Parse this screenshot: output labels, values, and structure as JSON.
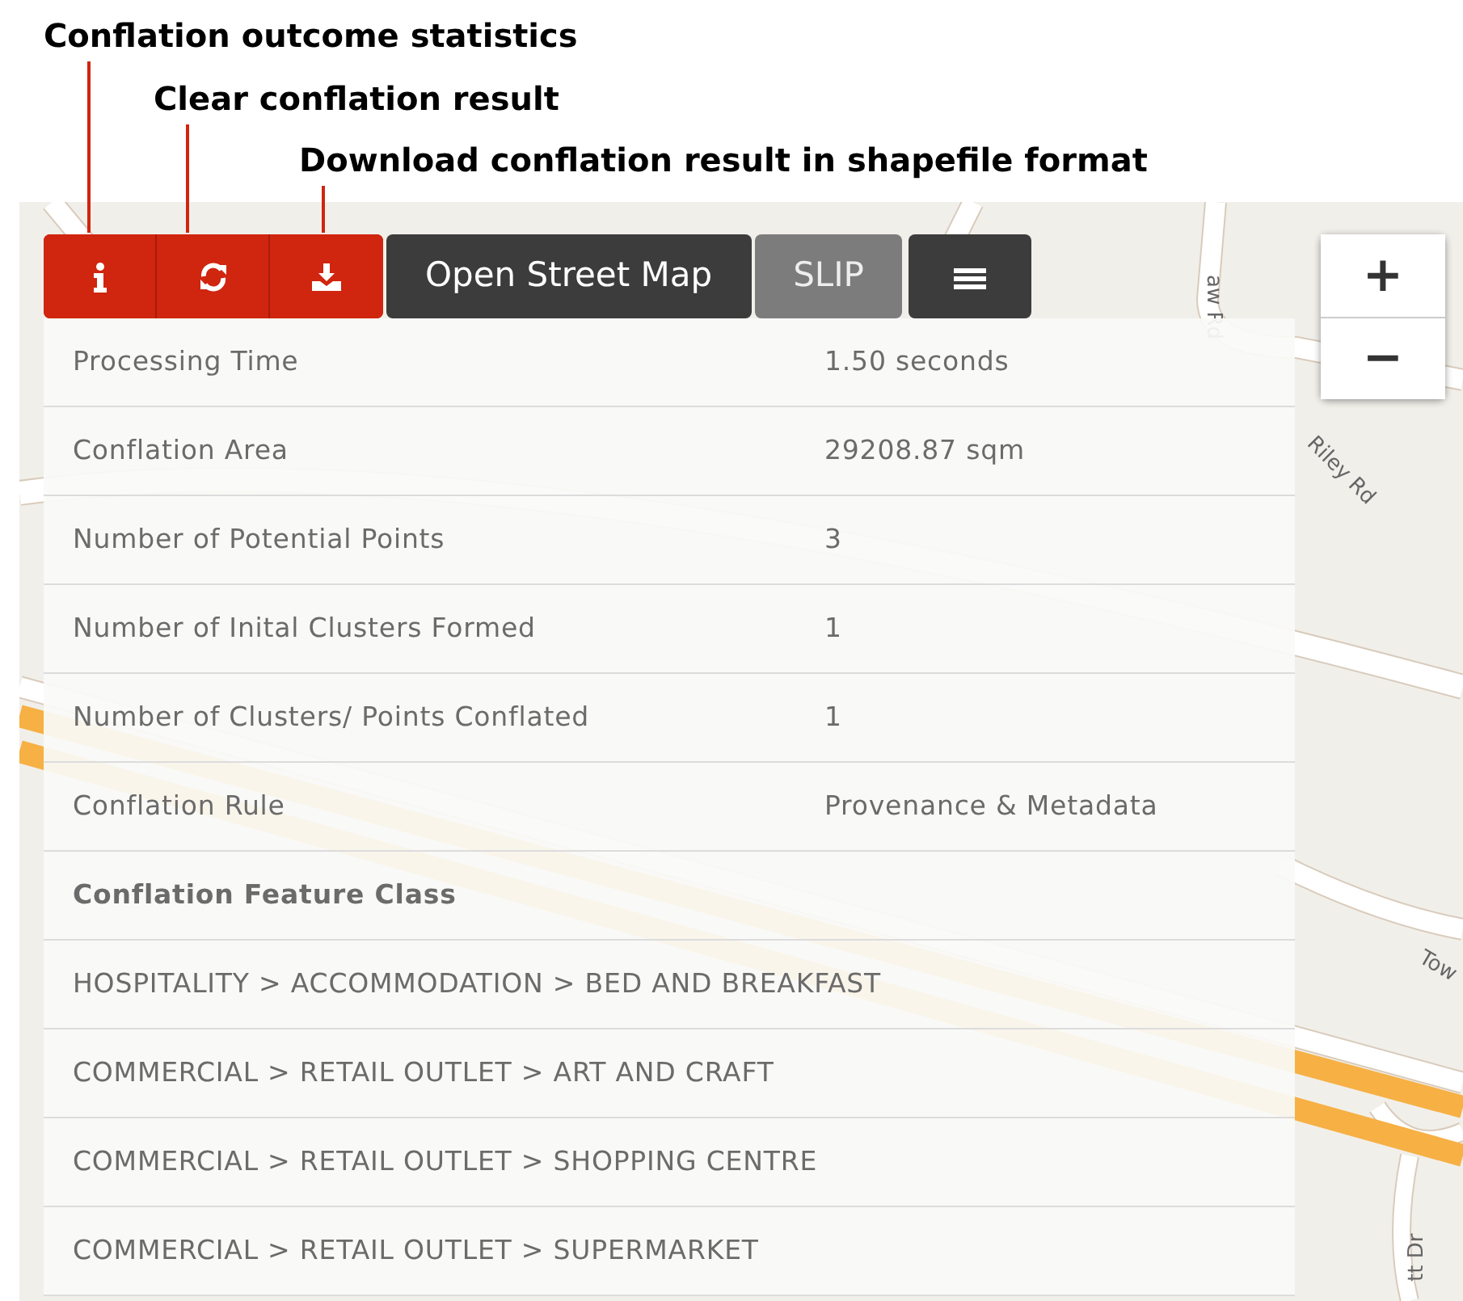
{
  "annotations": [
    {
      "text": "Conflation outcome statistics"
    },
    {
      "text": "Clear conflation result"
    },
    {
      "text": "Download conflation result in shapefile format"
    }
  ],
  "toolbar": {
    "tool_buttons": [
      {
        "kind": "info"
      },
      {
        "kind": "refresh"
      },
      {
        "kind": "download"
      }
    ],
    "layer_buttons": [
      {
        "label": "Open Street Map",
        "selected": false
      },
      {
        "label": "SLIP",
        "selected": true
      }
    ],
    "menu_button": {
      "kind": "menu"
    }
  },
  "zoom_control": {
    "zoom_in": "+",
    "zoom_out": "−"
  },
  "map_labels": [
    {
      "text": "aw Rd"
    },
    {
      "text": "Riley Rd"
    },
    {
      "text": "Tow"
    },
    {
      "text": "tt Dr"
    }
  ],
  "statistics": [
    {
      "kind": "pair",
      "label": "Processing Time",
      "value": "1.50 seconds"
    },
    {
      "kind": "pair",
      "label": "Conflation Area",
      "value": "29208.87 sqm"
    },
    {
      "kind": "pair",
      "label": "Number of Potential Points",
      "value": "3"
    },
    {
      "kind": "pair",
      "label": "Number of Inital Clusters Formed",
      "value": "1"
    },
    {
      "kind": "pair",
      "label": "Number of Clusters/ Points Conflated",
      "value": "1"
    },
    {
      "kind": "pair",
      "label": "Conflation Rule",
      "value": "Provenance & Metadata"
    },
    {
      "kind": "heading",
      "label": "Conflation Feature Class"
    },
    {
      "kind": "item",
      "label": "HOSPITALITY > ACCOMMODATION > BED AND BREAKFAST"
    },
    {
      "kind": "item",
      "label": "COMMERCIAL > RETAIL OUTLET > ART AND CRAFT"
    },
    {
      "kind": "item",
      "label": "COMMERCIAL > RETAIL OUTLET > SHOPPING CENTRE"
    },
    {
      "kind": "item",
      "label": "COMMERCIAL > RETAIL OUTLET > SUPERMARKET"
    }
  ]
}
